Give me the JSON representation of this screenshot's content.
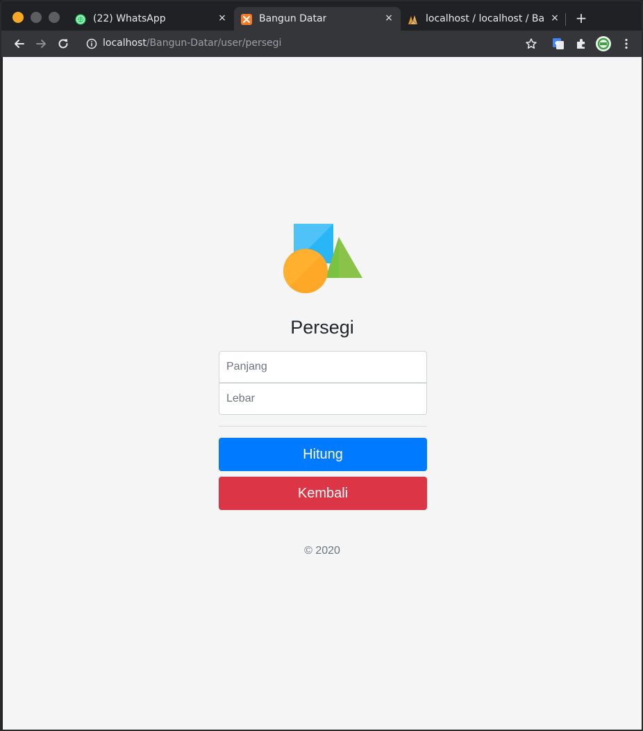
{
  "browser": {
    "tabs": [
      {
        "title": "(22) WhatsApp",
        "badge": "22",
        "active": false
      },
      {
        "title": "Bangun Datar",
        "active": true
      },
      {
        "title": "localhost / localhost / Bangun",
        "active": false
      }
    ],
    "tab_close_symbol": "×",
    "new_tab_symbol": "+",
    "url_host": "localhost",
    "url_path": "/Bangun-Datar/user/persegi"
  },
  "page": {
    "heading": "Persegi",
    "fields": {
      "panjang_placeholder": "Panjang",
      "lebar_placeholder": "Lebar"
    },
    "buttons": {
      "hitung": "Hitung",
      "kembali": "Kembali"
    },
    "footer": "© 2020"
  },
  "colors": {
    "primary": "#007bff",
    "danger": "#dc3545",
    "page_bg": "#f5f5f5",
    "logo_square": "#4fc3f7",
    "logo_triangle": "#7cc242",
    "logo_circle": "#ffa726"
  },
  "icons": [
    "whatsapp-icon",
    "xampp-icon",
    "phpmyadmin-icon",
    "back-icon",
    "forward-icon",
    "reload-icon",
    "info-icon",
    "star-icon",
    "translate-icon",
    "extensions-icon",
    "profile-icon",
    "menu-icon"
  ]
}
